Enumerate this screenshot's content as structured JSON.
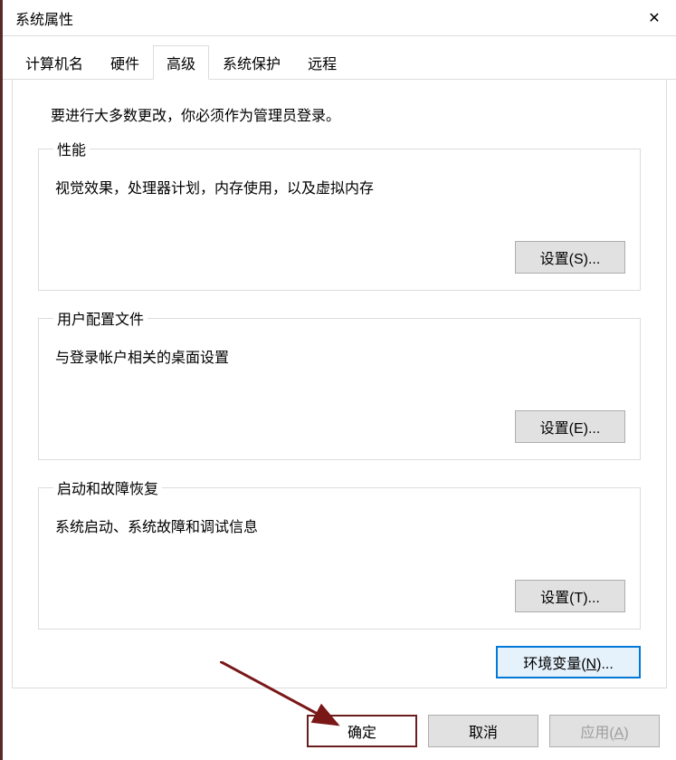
{
  "window": {
    "title": "系统属性",
    "close_label": "✕"
  },
  "tabs": {
    "computer_name": "计算机名",
    "hardware": "硬件",
    "advanced": "高级",
    "system_protection": "系统保护",
    "remote": "远程"
  },
  "advanced_panel": {
    "admin_notice": "要进行大多数更改，你必须作为管理员登录。",
    "performance": {
      "legend": "性能",
      "desc": "视觉效果，处理器计划，内存使用，以及虚拟内存",
      "settings_btn": "设置(S)..."
    },
    "user_profiles": {
      "legend": "用户配置文件",
      "desc": "与登录帐户相关的桌面设置",
      "settings_btn": "设置(E)..."
    },
    "startup_recovery": {
      "legend": "启动和故障恢复",
      "desc": "系统启动、系统故障和调试信息",
      "settings_btn": "设置(T)..."
    },
    "env_btn_prefix": "环境变量(",
    "env_btn_mnemonic": "N",
    "env_btn_suffix": ")..."
  },
  "dialog_buttons": {
    "ok": "确定",
    "cancel": "取消",
    "apply_prefix": "应用(",
    "apply_mnemonic": "A",
    "apply_suffix": ")"
  }
}
